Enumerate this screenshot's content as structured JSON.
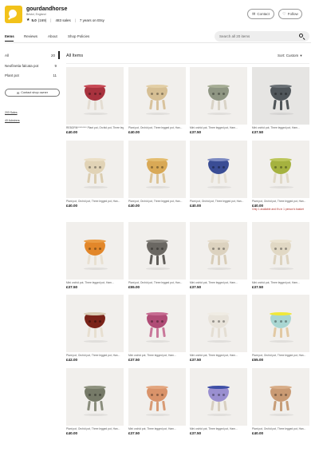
{
  "shop": {
    "name": "gourdandhorse",
    "location": "Bristol, England",
    "rating": "5.0",
    "review_count": "(169)",
    "sales": "483 sales",
    "years": "7 years on Etsy",
    "contact_label": "Contact",
    "follow_label": "Follow"
  },
  "tabs": [
    "Items",
    "Reviews",
    "About",
    "Shop Policies"
  ],
  "search": {
    "placeholder": "Search all 20 items"
  },
  "sidebar": {
    "categories": [
      {
        "label": "All",
        "count": "20"
      },
      {
        "label": "Neofinetia falcata pot",
        "count": "9"
      },
      {
        "label": "Plant pot",
        "count": "11"
      }
    ],
    "contact_owner": "Contact shop owner",
    "links": [
      "203 Sales",
      "40 Admirers"
    ]
  },
  "main": {
    "heading": "All Items",
    "sort_label": "Sort: Custom"
  },
  "colors": {
    "accent_yellow": "#f2c21a",
    "alert_red": "#b0302a"
  },
  "items": [
    {
      "title": "REBORN********* Plant pot, Orchid pot, Three legged pot",
      "price": "£40.00",
      "pot": "#a8323e",
      "rim": "#c74a55",
      "legs": "#e4ddd2",
      "dark": false
    },
    {
      "title": "Plant pot, Orchid pot, Three legged pot, Han...",
      "price": "£40.00",
      "pot": "#d6bf94",
      "rim": "#e3cfa6",
      "legs": "#d8c29c",
      "dark": false
    },
    {
      "title": "Mini orchid pot, Three legged pot, Ham...",
      "price": "£37.50",
      "pot": "#8f9683",
      "rim": "#a6ad95",
      "legs": "#d9d3c6",
      "dark": false
    },
    {
      "title": "Mini orchid pot, Three legged pot, Ham...",
      "price": "£37.50",
      "pot": "#50565b",
      "rim": "#6a7075",
      "legs": "#4f5558",
      "dark": true
    },
    {
      "title": "Plant pot, Orchid pot, Three legged pot, Han...",
      "price": "£40.00",
      "pot": "#e1d3b6",
      "rim": "#ebdfc6",
      "legs": "#dbcdb0",
      "dark": false
    },
    {
      "title": "Plant pot, Orchid pot, Three legged pot, Han...",
      "price": "£40.00",
      "pot": "#d9a956",
      "rim": "#e4bd6f",
      "legs": "#dcc497",
      "dark": false
    },
    {
      "title": "Plant pot, Orchid pot, Three legged pot, Han...",
      "price": "£40.00",
      "pot": "#3a4d95",
      "rim": "#7c8ac2",
      "legs": "#e5dfd3",
      "dark": false
    },
    {
      "title": "Plant pot, Orchid pot, Three legged pot, Han...",
      "price": "£40.00",
      "pot": "#a5b23f",
      "rim": "#bcc65a",
      "legs": "#e0d9c8",
      "dark": false,
      "note": "Only 1 available and it's in 1 person's basket"
    },
    {
      "title": "Mini orchid pot, Three legged pot, Ham...",
      "price": "£37.50",
      "pot": "#e2872a",
      "rim": "#ea9c44",
      "legs": "#e8e0d1",
      "dark": false
    },
    {
      "title": "Plant pot, Orchid pot, Three legged pot, Han...",
      "price": "£55.00",
      "pot": "#6a6762",
      "rim": "#85827c",
      "legs": "#605d59",
      "dark": false
    },
    {
      "title": "Mini orchid pot, Three legged pot, Ham...",
      "price": "£37.50",
      "pot": "#dcd2bf",
      "rim": "#e6ddcc",
      "legs": "#d8cdb8",
      "dark": false
    },
    {
      "title": "Mini orchid pot, Three legged pot, Ham...",
      "price": "£37.50",
      "pot": "#e1d8c4",
      "rim": "#ebe3d1",
      "legs": "#ddd3bf",
      "dark": false
    },
    {
      "title": "Plant pot, Orchid pot, Three legged pot, Han...",
      "price": "£42.00",
      "pot": "#7a2319",
      "rim": "#d8cbb3",
      "legs": "#e7dfd0",
      "dark": false
    },
    {
      "title": "Mini orchid pot, Three legged pot, Ham...",
      "price": "£37.50",
      "pot": "#b04c76",
      "rim": "#c66b91",
      "legs": "#c9779a",
      "dark": false
    },
    {
      "title": "Mini orchid pot, Three legged pot, Ham...",
      "price": "£37.50",
      "pot": "#e8e3da",
      "rim": "#f0ece4",
      "legs": "#e4ded3",
      "dark": false
    },
    {
      "title": "Plant pot, Orchid pot, Three legged pot, Han...",
      "price": "£55.00",
      "pot": "#a9d6d2",
      "rim": "#f0e83a",
      "legs": "#e2c9a3",
      "dark": false
    },
    {
      "title": "Plant pot, Orchid pot, Three legged pot, Han...",
      "price": "£40.00",
      "pot": "#767a68",
      "rim": "#8e927f",
      "legs": "#8a8d7c",
      "dark": false
    },
    {
      "title": "Mini orchid pot, Three legged pot, Ham...",
      "price": "£37.50",
      "pot": "#d9936a",
      "rim": "#e3a67f",
      "legs": "#d89a73",
      "dark": false
    },
    {
      "title": "Mini orchid pot, Three legged pot, Ham...",
      "price": "£37.50",
      "pot": "#9a8fd0",
      "rim": "#3e4fa6",
      "legs": "#d8cfc0",
      "dark": false
    },
    {
      "title": "Plant pot, Orchid pot, Three legged pot, Han...",
      "price": "£40.00",
      "pot": "#c99a73",
      "rim": "#d8ad88",
      "legs": "#c79d77",
      "dark": false
    }
  ]
}
